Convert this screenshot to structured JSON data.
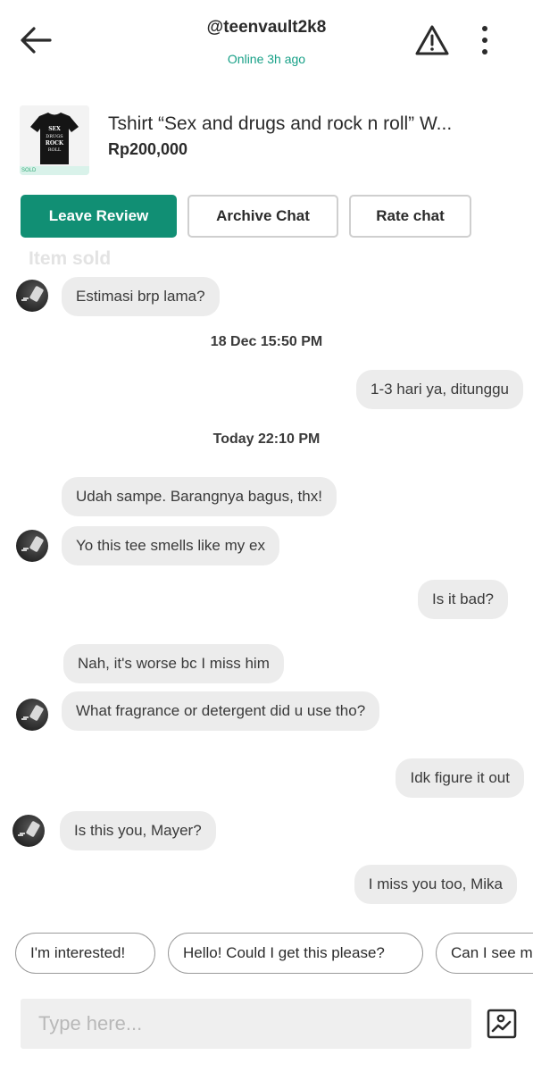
{
  "header": {
    "username": "@teenvault2k8",
    "status": "Online 3h ago",
    "back_icon": "arrow-left-icon",
    "report_icon": "warning-triangle-icon",
    "more_icon": "more-vertical-icon"
  },
  "product": {
    "title": "Tshirt “Sex and drugs and rock n roll” W...",
    "price": "Rp200,000",
    "thumb_badge": "SOLD",
    "thumb_shirt_text": "SEX and DRUGS and ROCK n ROLL"
  },
  "actions": {
    "leave_review": "Leave Review",
    "archive_chat": "Archive Chat",
    "rate_chat": "Rate chat"
  },
  "status_label": "Item sold",
  "chat": {
    "messages": [
      {
        "text": "Estimasi brp lama?",
        "side": "left"
      },
      {
        "text": "18 Dec 15:50 PM",
        "side": "date"
      },
      {
        "text": "1-3 hari ya, ditunggu",
        "side": "right"
      },
      {
        "text": "Today 22:10 PM",
        "side": "date"
      },
      {
        "text": "Udah sampe. Barangnya bagus, thx!",
        "side": "left"
      },
      {
        "text": "Yo this tee smells like my ex",
        "side": "left"
      },
      {
        "text": "Is it bad?",
        "side": "right"
      },
      {
        "text": "Nah, it's worse bc I miss him",
        "side": "left"
      },
      {
        "text": "What fragrance or detergent did u use tho?",
        "side": "left"
      },
      {
        "text": "Idk figure it out",
        "side": "right"
      },
      {
        "text": "Is this you, Mayer?",
        "side": "left"
      },
      {
        "text": "I miss you too, Mika",
        "side": "right"
      }
    ]
  },
  "quick_replies": [
    "I'm interested!",
    "Hello! Could I get this please?",
    "Can I see m"
  ],
  "composer": {
    "placeholder": "Type here...",
    "image_icon": "image-upload-icon"
  },
  "colors": {
    "accent": "#118f74",
    "online": "#17a087",
    "bubble": "#ececec"
  }
}
